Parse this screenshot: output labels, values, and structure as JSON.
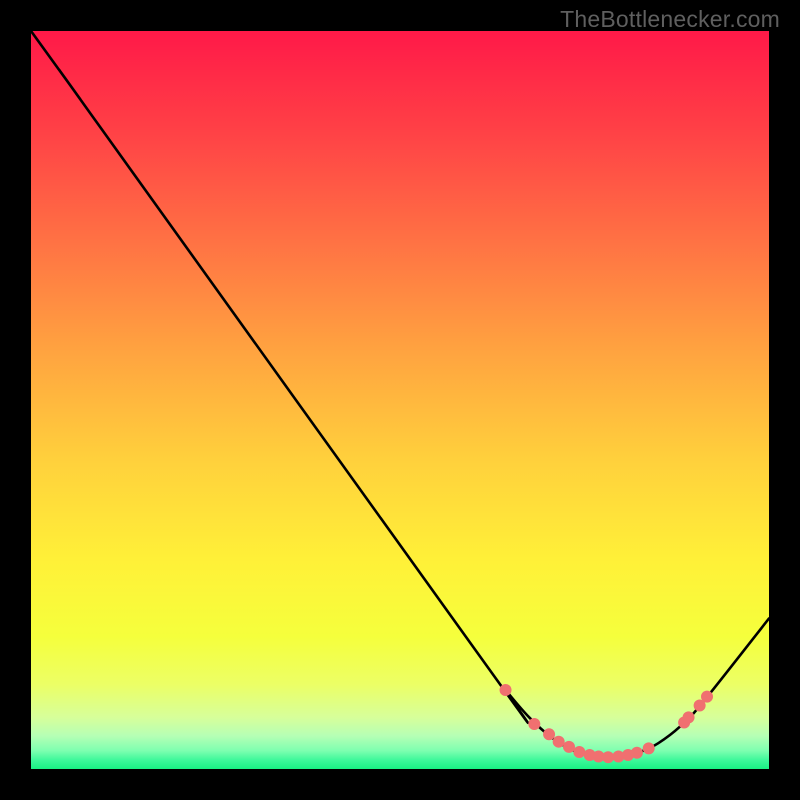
{
  "attribution": "TheBottlenecker.com",
  "chart_data": {
    "type": "line",
    "title": "",
    "xlabel": "",
    "ylabel": "",
    "xlim": [
      0,
      100
    ],
    "ylim": [
      0,
      100
    ],
    "background_gradient": {
      "top": "#ff1948",
      "upper_mid": "#ff8243",
      "mid": "#ffe139",
      "lower_mid": "#f7ff3b",
      "low": "#baffad",
      "bottom_thin": "#22f58a"
    },
    "curve": {
      "description": "bottleneck curve, V-shaped, minimum around x≈78",
      "points": [
        {
          "x": 0.0,
          "y": 100.0
        },
        {
          "x": 6.5,
          "y": 91.0
        },
        {
          "x": 8.5,
          "y": 88.2
        },
        {
          "x": 62.6,
          "y": 12.8
        },
        {
          "x": 64.3,
          "y": 10.7
        },
        {
          "x": 67.5,
          "y": 7.0
        },
        {
          "x": 70.5,
          "y": 4.3
        },
        {
          "x": 73.5,
          "y": 2.5
        },
        {
          "x": 76.5,
          "y": 1.7
        },
        {
          "x": 79.5,
          "y": 1.7
        },
        {
          "x": 82.5,
          "y": 2.3
        },
        {
          "x": 85.0,
          "y": 3.5
        },
        {
          "x": 88.0,
          "y": 5.8
        },
        {
          "x": 91.0,
          "y": 9.0
        },
        {
          "x": 100.0,
          "y": 20.4
        }
      ]
    },
    "markers": {
      "description": "salmon dots clustered along the trough",
      "color": "#f07070",
      "radius_px": 6,
      "points": [
        {
          "x": 64.3,
          "y": 10.7
        },
        {
          "x": 68.2,
          "y": 6.1
        },
        {
          "x": 70.2,
          "y": 4.7
        },
        {
          "x": 71.5,
          "y": 3.7
        },
        {
          "x": 72.9,
          "y": 3.0
        },
        {
          "x": 74.3,
          "y": 2.3
        },
        {
          "x": 75.7,
          "y": 1.9
        },
        {
          "x": 76.9,
          "y": 1.7
        },
        {
          "x": 78.2,
          "y": 1.6
        },
        {
          "x": 79.6,
          "y": 1.7
        },
        {
          "x": 80.9,
          "y": 1.9
        },
        {
          "x": 82.1,
          "y": 2.2
        },
        {
          "x": 83.7,
          "y": 2.8
        },
        {
          "x": 88.5,
          "y": 6.3
        },
        {
          "x": 89.1,
          "y": 7.0
        },
        {
          "x": 90.6,
          "y": 8.6
        },
        {
          "x": 91.6,
          "y": 9.8
        }
      ]
    }
  }
}
